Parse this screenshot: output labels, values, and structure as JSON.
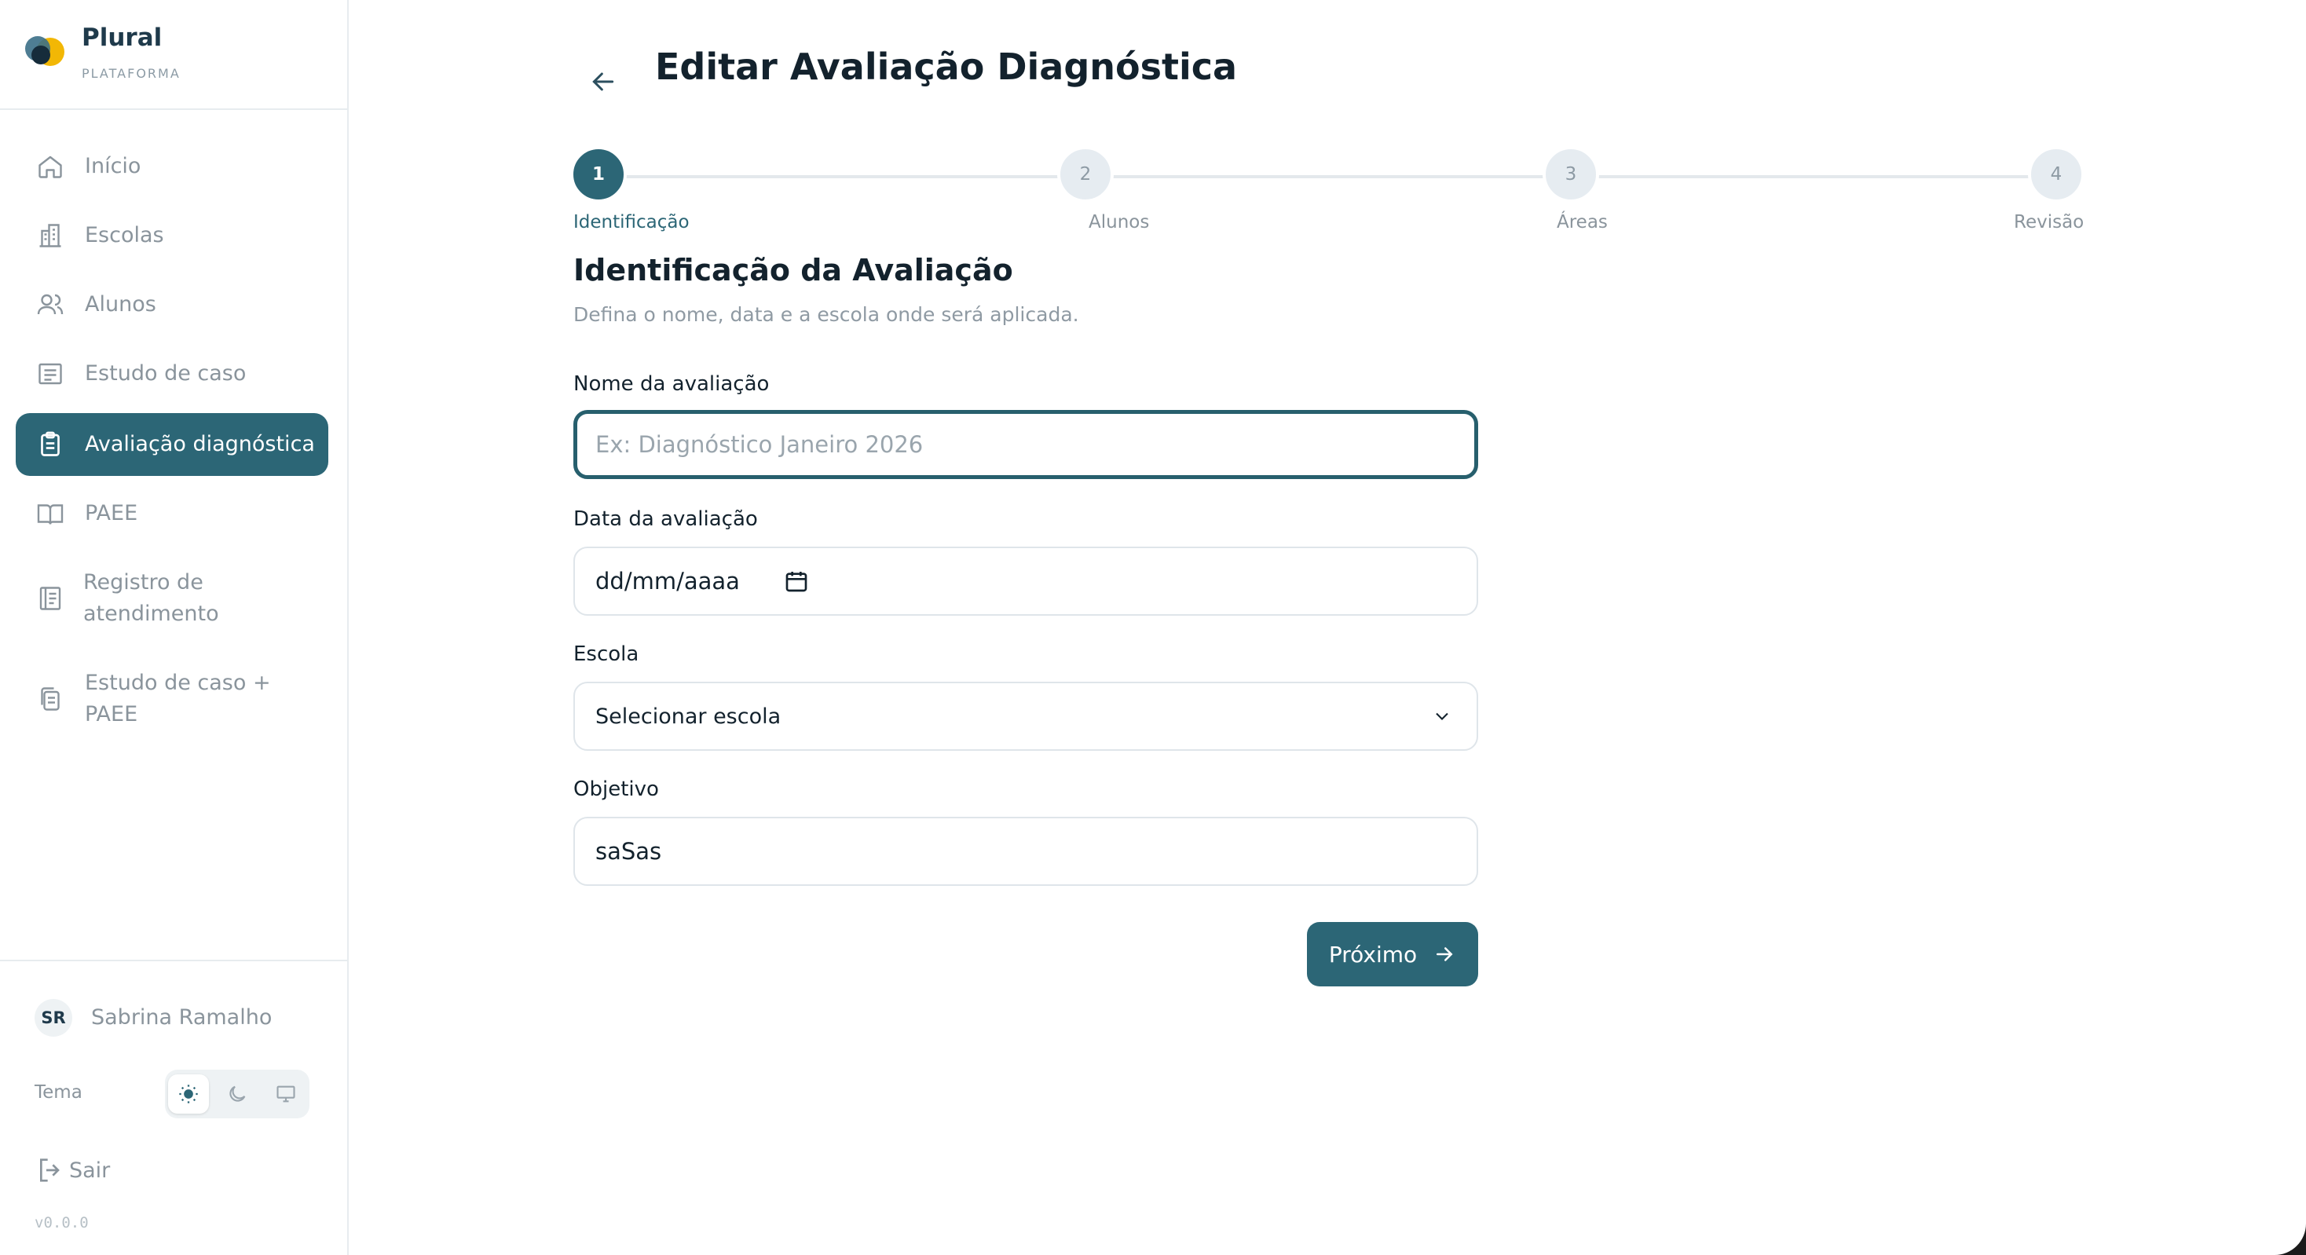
{
  "brand": {
    "name": "Plural",
    "subtitle": "PLATAFORMA"
  },
  "sidebar": {
    "items": [
      {
        "label": "Início",
        "icon": "home-icon",
        "active": false
      },
      {
        "label": "Escolas",
        "icon": "building-icon",
        "active": false
      },
      {
        "label": "Alunos",
        "icon": "users-icon",
        "active": false
      },
      {
        "label": "Estudo de caso",
        "icon": "document-list-icon",
        "active": false
      },
      {
        "label": "Avaliação diagnóstica",
        "icon": "clipboard-icon",
        "active": true
      },
      {
        "label": "PAEE",
        "icon": "book-open-icon",
        "active": false
      },
      {
        "label": "Registro de atendimento",
        "icon": "notebook-icon",
        "active": false
      },
      {
        "label": "Estudo de caso + PAEE",
        "icon": "copy-documents-icon",
        "active": false
      }
    ],
    "user": {
      "initials": "SR",
      "name": "Sabrina Ramalho"
    },
    "theme": {
      "label": "Tema",
      "options": [
        "sun-icon",
        "moon-icon",
        "monitor-icon"
      ],
      "selected": "sun-icon"
    },
    "logout_label": "Sair",
    "version": "v0.0.0"
  },
  "main": {
    "title": "Editar Avaliação Diagnóstica",
    "steps": [
      {
        "number": "1",
        "label": "Identificação",
        "active": true
      },
      {
        "number": "2",
        "label": "Alunos",
        "active": false
      },
      {
        "number": "3",
        "label": "Áreas",
        "active": false
      },
      {
        "number": "4",
        "label": "Revisão",
        "active": false
      }
    ],
    "section_title": "Identificação da Avaliação",
    "section_subtitle": "Defina o nome, data e a escola onde será aplicada.",
    "form": {
      "name_label": "Nome da avaliação",
      "name_placeholder": "Ex: Diagnóstico Janeiro 2026",
      "name_value": "",
      "date_label": "Data da avaliação",
      "date_value": "dd/mm/aaaa",
      "school_label": "Escola",
      "school_value": "Selecionar escola",
      "objective_label": "Objetivo",
      "objective_value": "saSas"
    },
    "next_label": "Próximo"
  },
  "colors": {
    "accent": "#2c6676",
    "text": "#13222d",
    "muted": "#8a949c",
    "border": "#dfe5ea"
  }
}
